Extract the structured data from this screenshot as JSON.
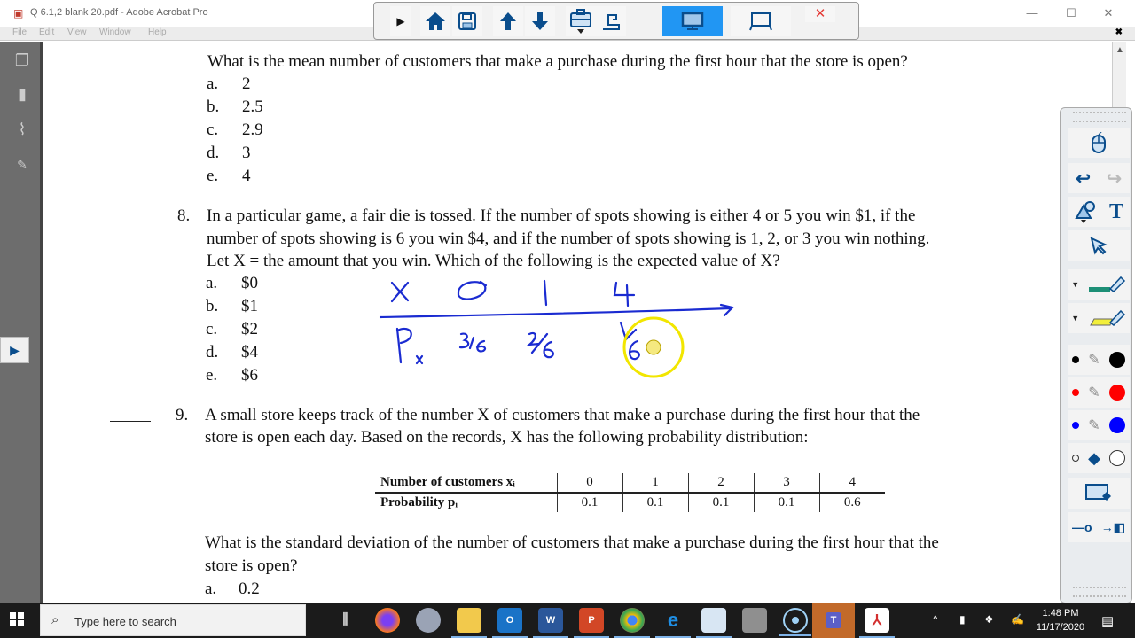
{
  "window": {
    "title": "Q 6.1,2  blank 20.pdf - Adobe Acrobat Pro",
    "minimize_icon": "minimize-icon",
    "maximize_icon": "maximize-icon",
    "close_icon": "close-icon"
  },
  "menubar": {
    "items": [
      "File",
      "Edit",
      "View",
      "Window",
      "Help"
    ],
    "close_glyph": "✖"
  },
  "float_toolbar": {
    "buttons": [
      "play-icon",
      "home-icon",
      "save-icon",
      "page-up-icon",
      "page-down-icon",
      "toolbox-icon",
      "document-camera-icon",
      "desktop-mode-icon",
      "whiteboard-mode-icon",
      "close-icon"
    ],
    "close_glyph": "✕"
  },
  "left_pane": {
    "icons": [
      "pages-icon",
      "bookmarks-icon",
      "attachments-icon",
      "signatures-icon"
    ],
    "expand_glyph": "▶"
  },
  "document": {
    "q7_tail": {
      "question": "What is the mean number of customers that make a purchase during the first hour that the store is open?",
      "options": [
        {
          "letter": "a.",
          "text": "2"
        },
        {
          "letter": "b.",
          "text": "2.5"
        },
        {
          "letter": "c.",
          "text": "2.9"
        },
        {
          "letter": "d.",
          "text": "3"
        },
        {
          "letter": "e.",
          "text": "4"
        }
      ]
    },
    "q8": {
      "number": "8.",
      "lines": [
        "In a particular game, a fair die is tossed.  If the number of spots showing is either 4 or 5 you win $1, if the",
        "number of spots showing is 6 you win $4, and if the number of spots showing is 1, 2, or 3 you win nothing.",
        "Let X = the amount that you win. Which of the following is the expected value of X?"
      ],
      "options": [
        {
          "letter": "a.",
          "text": "$0"
        },
        {
          "letter": "b.",
          "text": "$1"
        },
        {
          "letter": "c.",
          "text": "$2"
        },
        {
          "letter": "d.",
          "text": "$4"
        },
        {
          "letter": "e.",
          "text": "$6"
        }
      ]
    },
    "handwriting": {
      "color": "#1a2bd1",
      "row_x": [
        "X",
        "0",
        "1",
        "4"
      ],
      "row_p": [
        "Pₓ",
        "3/6",
        "2/6",
        "1/6"
      ],
      "cursor_highlight_color": "#f2e600"
    },
    "q9": {
      "number": "9.",
      "lines": [
        "A small store keeps track of the number X of customers that make a purchase during the first hour that the",
        "store is open each day.  Based on the records, X has the following probability distribution:"
      ],
      "table": {
        "row_labels": [
          "Number of customers xᵢ",
          "Probability pᵢ"
        ],
        "x_values": [
          "0",
          "1",
          "2",
          "3",
          "4"
        ],
        "p_values": [
          "0.1",
          "0.1",
          "0.1",
          "0.1",
          "0.6"
        ]
      },
      "followup_lines": [
        "What is the standard deviation of the number of customers that make a purchase during the first hour that the",
        "store is open?"
      ],
      "options": [
        {
          "letter": "a.",
          "text": "0.2"
        }
      ]
    }
  },
  "pen_tools": {
    "tools": [
      "mouse-icon",
      "undo-icon",
      "redo-icon",
      "shapes-icon",
      "text-icon",
      "select-arrow-icon",
      "pen-icon",
      "highlighter-icon",
      "black-pen-icon",
      "red-pen-icon",
      "blue-pen-icon",
      "eraser-icon",
      "clear-screen-icon",
      "line-icon",
      "exit-icon"
    ],
    "text_glyph": "T",
    "colors": {
      "pen": "#1d8f76",
      "highlighter": "#f2ee3a",
      "black": "#000000",
      "red": "#ff0000",
      "blue": "#0000ff"
    }
  },
  "taskbar": {
    "search_placeholder": "Type here to search",
    "apps": [
      "task-view",
      "firefox",
      "snipping",
      "file-explorer",
      "outlook",
      "word",
      "powerpoint",
      "chrome",
      "edge",
      "smart-notebook",
      "printer",
      "cortana",
      "teams",
      "acrobat"
    ],
    "app_labels": {
      "outlook": "O",
      "word": "W",
      "powerpoint": "P",
      "teams": "T"
    },
    "time": "1:48 PM",
    "date": "11/17/2020"
  }
}
